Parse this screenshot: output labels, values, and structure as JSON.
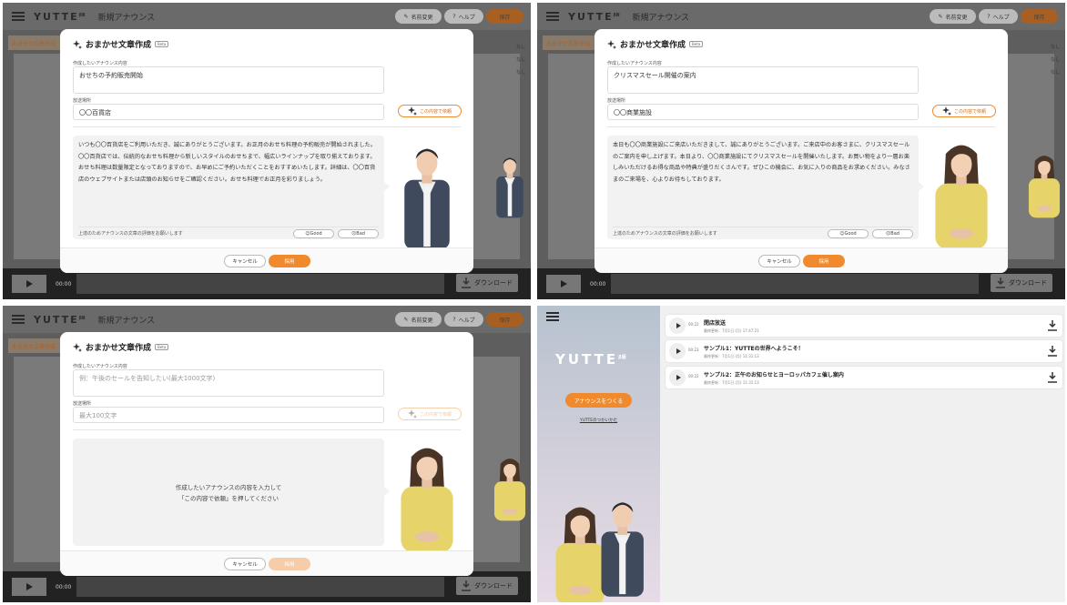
{
  "app": {
    "logo": "YUTTE",
    "logo_sup": "β版",
    "title": "新規アナウンス",
    "rename": "名前変更",
    "help": "ヘルプ",
    "save": "保存",
    "subtab": "おまかせ文章作成",
    "time": "00:00",
    "download": "ダウンロード"
  },
  "modal_common": {
    "title": "おまかせ文章作成",
    "beta": "Beta",
    "announce_label": "作成したいアナウンス内容",
    "place_label": "放送場所",
    "request_btn": "この内容で依頼",
    "eval_text": "上達のためアナウンスの文章の評価をお願いします",
    "good": "Good",
    "bad": "Bad",
    "cancel": "キャンセル",
    "adopt": "採用"
  },
  "panel1": {
    "announce": "おせちの予約販売開始",
    "place": "〇〇百貨店",
    "result": "いつも〇〇百貨店をご利用いただき、誠にありがとうございます。お正月のおせち料理の予約販売が開始されました。〇〇百貨店では、伝統的なおせち料理から新しいスタイルのおせちまで、幅広いラインナップを取り揃えております。おせち料理は数量限定となっておりますので、お早めにご予約いただくことをおすすめいたします。詳細は、〇〇百貨店のウェブサイトまたは店頭のお知らせをご確認ください。おせち料理でお正月を彩りましょう。"
  },
  "panel2": {
    "announce": "クリスマスセール開催の案内",
    "place": "〇〇商業施設",
    "result": "本日も〇〇商業施設にご来店いただきまして、誠にありがとうございます。ご来店中のお客さまに、クリスマスセールのご案内を申し上げます。本日より、〇〇商業施設にてクリスマスセールを開催いたします。お買い物をより一層お楽しみいただけるお得な商品や特典が盛りだくさんです。ぜひこの機会に、お気に入りの商品をお求めください。みなさまのご来場を、心よりお待ちしております。"
  },
  "panel3": {
    "announce_ph": "例：午後のセールを告知したい(最大1000文字)",
    "place_ph": "最大100文字",
    "hint_line1": "作成したいアナウンスの内容を入力して",
    "hint_line2": "「この内容で依頼」を押してください"
  },
  "panel4": {
    "logo": "YUTTE",
    "logo_sup": "β版",
    "make_btn": "アナウンスをつくる",
    "link": "YUTTEのつかいかた",
    "items": [
      {
        "duration": "00:22",
        "title": "閉店放送",
        "date": "最終更新：7月1日 (月) 17:47:21"
      },
      {
        "duration": "00:23",
        "title": "サンプル1：YUTTEの世界へようこそ！",
        "date": "最終更新：7月1日 (月) 11:31:13"
      },
      {
        "duration": "00:22",
        "title": "サンプル2：正午のお知らせとヨーロッパカフェ催し案内",
        "date": "最終更新：7月1日 (月) 11:31:13"
      }
    ]
  },
  "side_col": {
    "a": "なし",
    "b": "なし",
    "c": "なし"
  },
  "colors": {
    "accent": "#f08a2c",
    "dim": "#5e5e5e",
    "modal": "#ffffff"
  }
}
